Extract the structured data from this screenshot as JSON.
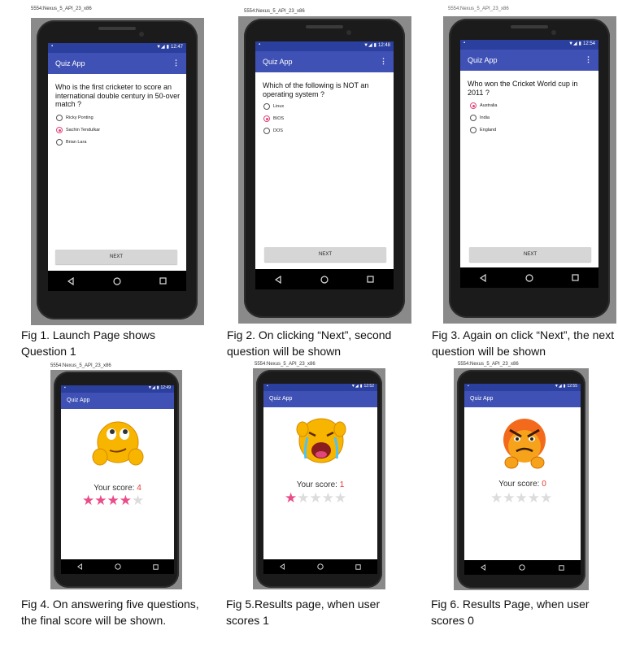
{
  "app_name": "Quiz App",
  "next_label": "NEXT",
  "menu_icon": "⋮",
  "emulator_title": "5554:Nexus_5_API_23_x86",
  "colors": {
    "appbar": "#3f51b5",
    "statusbar": "#2b3f9e",
    "accent": "#e0457b",
    "star_on": "#ea4c89",
    "star_off": "#dcdcdc",
    "score_num": "#e53935"
  },
  "panels": {
    "fig1": {
      "time": "12:47",
      "question": "Who is the first cricketer to score an international double century in 50-over match ?",
      "options": [
        "Ricky Ponting",
        "Sachin Tendulkar",
        "Brian Lara"
      ],
      "selected": 1,
      "caption": "Fig 1. Launch Page shows Question 1"
    },
    "fig2": {
      "time": "12:48",
      "question": "Which of the following is NOT an operating system ?",
      "options": [
        "Linux",
        "BIOS",
        "DOS"
      ],
      "selected": 1,
      "caption": "Fig 2. On clicking “Next”, second question will be shown"
    },
    "fig3": {
      "time": "12:54",
      "question": "Who won the Cricket World cup in 2011 ?",
      "options": [
        "Australia",
        "India",
        "England"
      ],
      "selected": 0,
      "caption": "Fig 3. Again on click “Next”, the next question will be shown"
    },
    "fig4": {
      "time": "12:49",
      "score_label": "Your score: ",
      "score": "4",
      "rating": 4,
      "emoji_icon": "thinking-emoji-icon",
      "caption": "Fig 4. On answering five questions, the final score will be shown."
    },
    "fig5": {
      "time": "12:52",
      "score_label": "Your score: ",
      "score": "1",
      "rating": 1,
      "emoji_icon": "crying-emoji-icon",
      "caption": "Fig 5.Results page, when user scores 1"
    },
    "fig6": {
      "time": "12:55",
      "score_label": "Your score: ",
      "score": "0",
      "rating": 0,
      "emoji_icon": "angry-emoji-icon",
      "caption": "Fig 6. Results Page, when user scores 0"
    }
  }
}
